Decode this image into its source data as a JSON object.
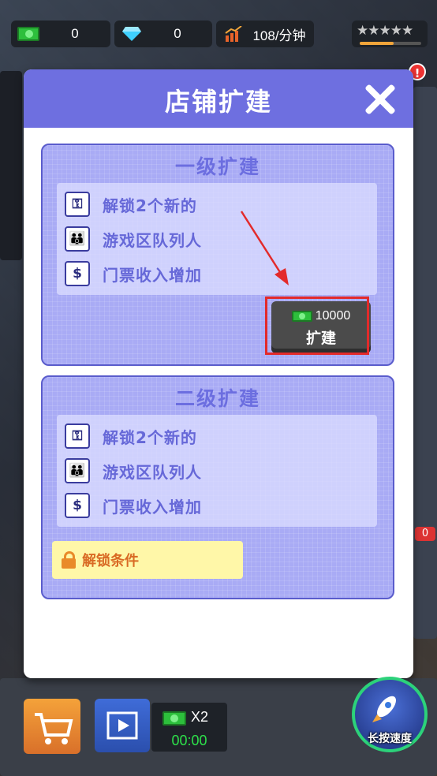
{
  "hud": {
    "cash": "0",
    "gems": "0",
    "income_rate": "108/分钟",
    "rating": "★★★★★",
    "rating_progress": 0.55
  },
  "dialog": {
    "title": "店铺扩建",
    "close_icon": "close-icon"
  },
  "level1": {
    "title": "一级扩建",
    "features": [
      {
        "icon": "person-key-icon",
        "text": "解锁2个新的"
      },
      {
        "icon": "queue-people-icon",
        "text": "游戏区队列人"
      },
      {
        "icon": "money-bag-icon",
        "text": "门票收入增加"
      }
    ],
    "button": {
      "cost": "10000",
      "label": "扩建"
    }
  },
  "level2": {
    "title": "二级扩建",
    "features": [
      {
        "icon": "person-key-icon",
        "text": "解锁2个新的"
      },
      {
        "icon": "queue-people-icon",
        "text": "游戏区队列人"
      },
      {
        "icon": "money-bag-icon",
        "text": "门票收入增加"
      }
    ],
    "lock": {
      "text": "解锁条件"
    }
  },
  "bottom": {
    "boost_multiplier": "X2",
    "boost_timer": "00:00",
    "speed_label": "长按速度"
  },
  "badges": {
    "top_alert": "!",
    "side_count": "0"
  },
  "colors": {
    "header": "#6e6fe0",
    "panel": "#a9abf5",
    "highlight": "#e32a2a",
    "button": "#4b4b4b"
  }
}
